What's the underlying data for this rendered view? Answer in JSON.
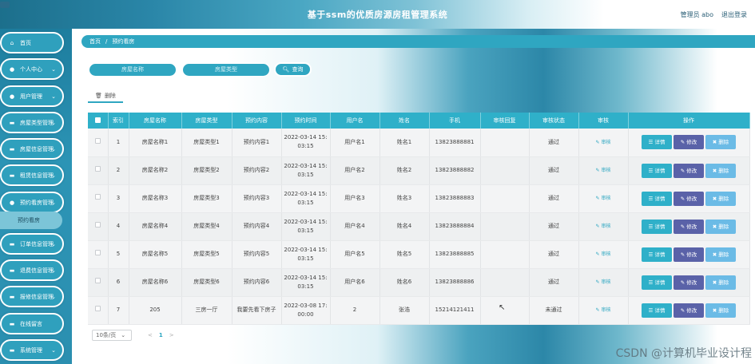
{
  "header": {
    "title": "基于ssm的优质房源房租管理系统",
    "admin_label": "管理员 abo",
    "logout_label": "退出登录"
  },
  "sidebar": {
    "items": [
      {
        "label": "首页",
        "icon": "home-icon",
        "chevron": false
      },
      {
        "label": "个人中心",
        "icon": "user-icon",
        "chevron": true
      },
      {
        "label": "用户管理",
        "icon": "user-icon",
        "chevron": true
      },
      {
        "label": "房屋类型管理",
        "icon": "comment-icon",
        "chevron": true
      },
      {
        "label": "房屋信息管理",
        "icon": "comment-icon",
        "chevron": true
      },
      {
        "label": "租赁信息管理",
        "icon": "comment-icon",
        "chevron": true
      },
      {
        "label": "预约看房管理",
        "icon": "user-icon",
        "chevron": true
      },
      {
        "label": "订单信息管理",
        "icon": "comment-icon",
        "chevron": true
      },
      {
        "label": "退费信息管理",
        "icon": "comment-icon",
        "chevron": true
      },
      {
        "label": "报修信息管理",
        "icon": "comment-icon",
        "chevron": true
      },
      {
        "label": "在线留言",
        "icon": "comment-icon",
        "chevron": false
      },
      {
        "label": "系统管理",
        "icon": "comment-icon",
        "chevron": true
      }
    ],
    "sub_item": "预约看房"
  },
  "breadcrumb": {
    "home": "首页",
    "separator": "/",
    "current": "预约看房"
  },
  "search": {
    "name_placeholder": "房屋名称",
    "type_placeholder": "房屋类型",
    "button_label": "查询"
  },
  "toolbar": {
    "delete_label": "删除"
  },
  "table": {
    "columns": [
      "索引",
      "房屋名称",
      "房屋类型",
      "预约内容",
      "预约时间",
      "用户名",
      "姓名",
      "手机",
      "审核回复",
      "审核状态",
      "审核",
      "操作"
    ],
    "rows": [
      {
        "index": "1",
        "name": "房屋名称1",
        "type": "房屋类型1",
        "content": "预约内容1",
        "time1": "2022-03-14 15:",
        "time2": "03:15",
        "username": "用户名1",
        "realname": "姓名1",
        "phone": "13823888881",
        "reply": "",
        "status": "通过"
      },
      {
        "index": "2",
        "name": "房屋名称2",
        "type": "房屋类型2",
        "content": "预约内容2",
        "time1": "2022-03-14 15:",
        "time2": "03:15",
        "username": "用户名2",
        "realname": "姓名2",
        "phone": "13823888882",
        "reply": "",
        "status": "通过"
      },
      {
        "index": "3",
        "name": "房屋名称3",
        "type": "房屋类型3",
        "content": "预约内容3",
        "time1": "2022-03-14 15:",
        "time2": "03:15",
        "username": "用户名3",
        "realname": "姓名3",
        "phone": "13823888883",
        "reply": "",
        "status": "通过"
      },
      {
        "index": "4",
        "name": "房屋名称4",
        "type": "房屋类型4",
        "content": "预约内容4",
        "time1": "2022-03-14 15:",
        "time2": "03:15",
        "username": "用户名4",
        "realname": "姓名4",
        "phone": "13823888884",
        "reply": "",
        "status": "通过"
      },
      {
        "index": "5",
        "name": "房屋名称5",
        "type": "房屋类型5",
        "content": "预约内容5",
        "time1": "2022-03-14 15:",
        "time2": "03:15",
        "username": "用户名5",
        "realname": "姓名5",
        "phone": "13823888885",
        "reply": "",
        "status": "通过"
      },
      {
        "index": "6",
        "name": "房屋名称6",
        "type": "房屋类型6",
        "content": "预约内容6",
        "time1": "2022-03-14 15:",
        "time2": "03:15",
        "username": "用户名6",
        "realname": "姓名6",
        "phone": "13823888886",
        "reply": "",
        "status": "通过"
      },
      {
        "index": "7",
        "name": "205",
        "type": "三房一厅",
        "content": "我要先看下房子",
        "time1": "2022-03-08 17:",
        "time2": "00:00",
        "username": "2",
        "realname": "张浩",
        "phone": "15214121411",
        "reply": "",
        "status": "未通过"
      }
    ],
    "audit_label": "审核",
    "detail_label": "详情",
    "edit_label": "修改",
    "delete_label": "删除"
  },
  "pager": {
    "page_size": "10条/页",
    "current_page": "1",
    "prev": "<",
    "next": ">"
  },
  "watermark": "CSDN @计算机毕业设计程",
  "colors": {
    "accent": "#2fb0c9",
    "edit": "#5a62a8",
    "delete": "#6bbbe6"
  }
}
